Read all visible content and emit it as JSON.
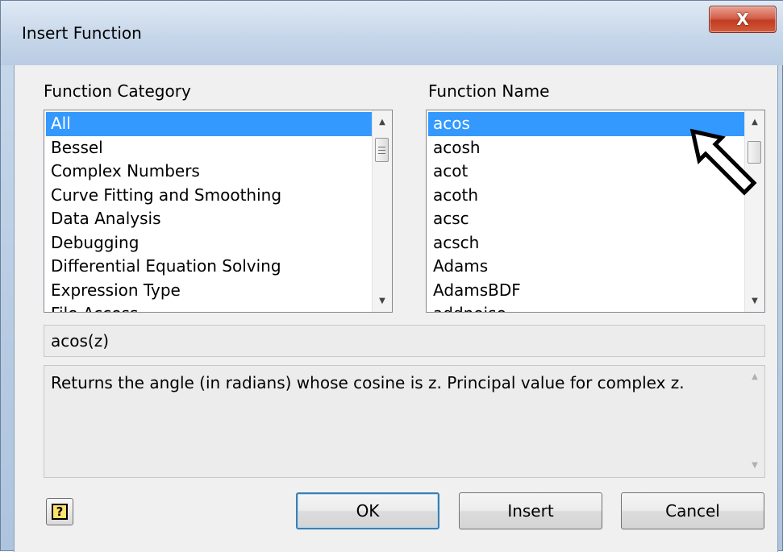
{
  "window": {
    "title": "Insert Function",
    "close_label": "X"
  },
  "category": {
    "label": "Function Category",
    "items": [
      "All",
      "Bessel",
      "Complex Numbers",
      "Curve Fitting and Smoothing",
      "Data Analysis",
      "Debugging",
      "Differential Equation Solving",
      "Expression Type",
      "File Access"
    ],
    "selected": "All"
  },
  "name": {
    "label": "Function Name",
    "items": [
      "acos",
      "acosh",
      "acot",
      "acoth",
      "acsc",
      "acsch",
      "Adams",
      "AdamsBDF",
      "addnoise"
    ],
    "selected": "acos"
  },
  "signature": "acos(z)",
  "description": "Returns the angle (in radians) whose cosine is z. Principal value for complex z.",
  "buttons": {
    "help_glyph": "?",
    "ok": "OK",
    "insert": "Insert",
    "cancel": "Cancel"
  },
  "colors": {
    "selection": "#3399ff",
    "close_button": "#c13c22"
  }
}
